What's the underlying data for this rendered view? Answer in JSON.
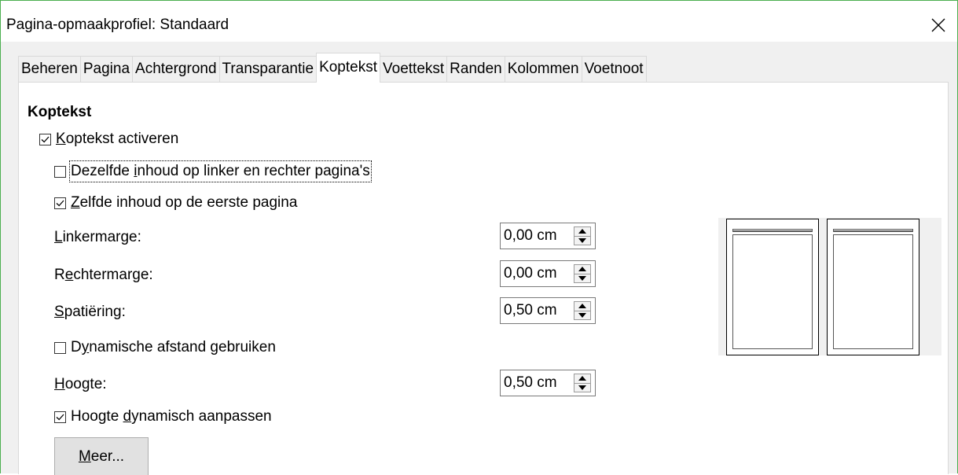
{
  "window": {
    "title": "Pagina-opmaakprofiel: Standaard"
  },
  "tabs": [
    {
      "label": "Beheren"
    },
    {
      "label": "Pagina"
    },
    {
      "label": "Achtergrond"
    },
    {
      "label": "Transparantie"
    },
    {
      "label": "Koptekst",
      "active": true
    },
    {
      "label": "Voettekst"
    },
    {
      "label": "Randen"
    },
    {
      "label": "Kolommen"
    },
    {
      "label": "Voetnoot"
    }
  ],
  "header": {
    "section_title": "Koptekst",
    "enable_header": {
      "checked": true,
      "mnemonic": "K",
      "rest": "optekst activeren"
    },
    "same_content_lr": {
      "checked": false,
      "pre": "Dezelfde ",
      "mnemonic": "i",
      "rest": "nhoud op linker en rechter pagina's"
    },
    "same_content_first": {
      "checked": true,
      "mnemonic": "Z",
      "rest": "elfde inhoud op de eerste pagina"
    },
    "left_margin": {
      "mnemonic": "L",
      "rest": "inkermarge:",
      "value": "0,00 cm"
    },
    "right_margin": {
      "pre": "R",
      "mnemonic": "e",
      "rest": "chtermarge:",
      "value": "0,00 cm"
    },
    "spacing": {
      "mnemonic": "S",
      "rest": "patiëring:",
      "value": "0,50 cm"
    },
    "dynamic_spacing": {
      "checked": false,
      "pre": "D",
      "mnemonic": "y",
      "rest": "namische afstand gebruiken"
    },
    "height": {
      "mnemonic": "H",
      "rest": "oogte:",
      "value": "0,50 cm"
    },
    "autofit_height": {
      "checked": true,
      "pre": "Hoogte ",
      "mnemonic": "d",
      "rest": "ynamisch aanpassen"
    },
    "more_button": {
      "mnemonic": "M",
      "rest": "eer..."
    }
  },
  "colors": {
    "window_border": "#4caf50",
    "panel_bg": "#ffffff",
    "dialog_bg": "#f0f0f0"
  }
}
